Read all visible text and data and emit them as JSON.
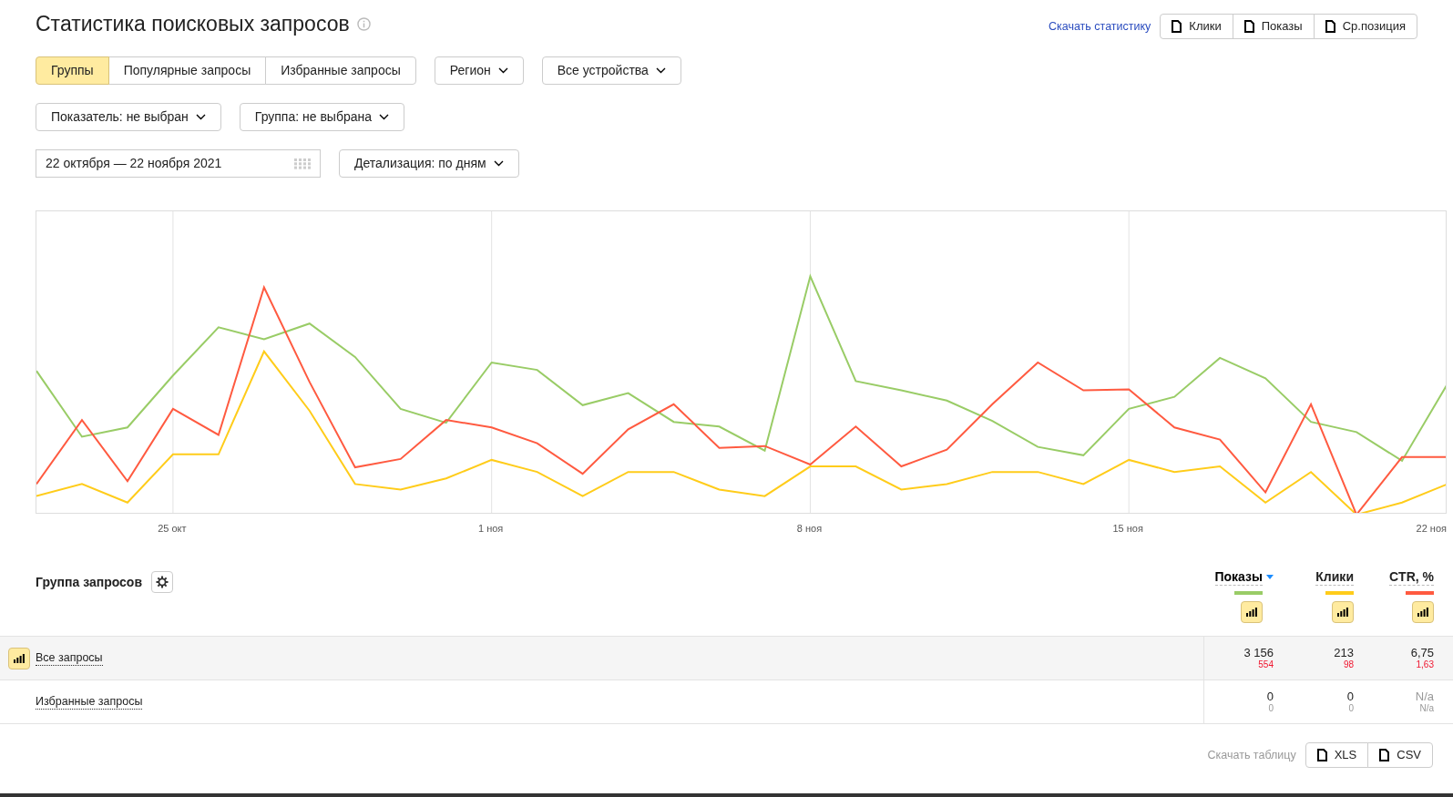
{
  "title": "Статистика поисковых запросов",
  "download_stats": {
    "label": "Скачать статистику",
    "buttons": [
      "Клики",
      "Показы",
      "Ср.позиция"
    ]
  },
  "tabs": [
    {
      "label": "Группы",
      "selected": true
    },
    {
      "label": "Популярные запросы",
      "selected": false
    },
    {
      "label": "Избранные запросы",
      "selected": false
    }
  ],
  "dropdowns_row1": [
    "Регион",
    "Все устройства"
  ],
  "dropdowns_row2": [
    "Показатель: не выбран",
    "Группа: не выбрана"
  ],
  "date_range": {
    "value": "22 октября — 22 ноября 2021"
  },
  "detail_dropdown": "Детализация: по дням",
  "chart": {
    "x_labels": [
      "25 окт",
      "1 ноя",
      "8 ноя",
      "15 ноя",
      "22 ноя"
    ]
  },
  "table": {
    "title": "Группа запросов",
    "columns": [
      {
        "label": "Показы",
        "sorted": true,
        "color": "#99cc66",
        "on": true
      },
      {
        "label": "Клики",
        "sorted": false,
        "color": "#ffcc1a",
        "on": true
      },
      {
        "label": "CTR, %",
        "sorted": false,
        "color": "#ff5a40",
        "on": true
      }
    ],
    "rows": [
      {
        "name": "Все запросы",
        "selected": true,
        "values": [
          {
            "main": "3 156",
            "sub": "554"
          },
          {
            "main": "213",
            "sub": "98"
          },
          {
            "main": "6,75",
            "sub": "1,63"
          }
        ]
      },
      {
        "name": "Избранные запросы",
        "selected": false,
        "values": [
          {
            "main": "0",
            "sub": "0"
          },
          {
            "main": "0",
            "sub": "0"
          },
          {
            "main": "N/a",
            "sub": "N/a"
          }
        ]
      }
    ]
  },
  "download_table": {
    "label": "Скачать таблицу",
    "buttons": [
      "XLS",
      "CSV"
    ]
  }
}
